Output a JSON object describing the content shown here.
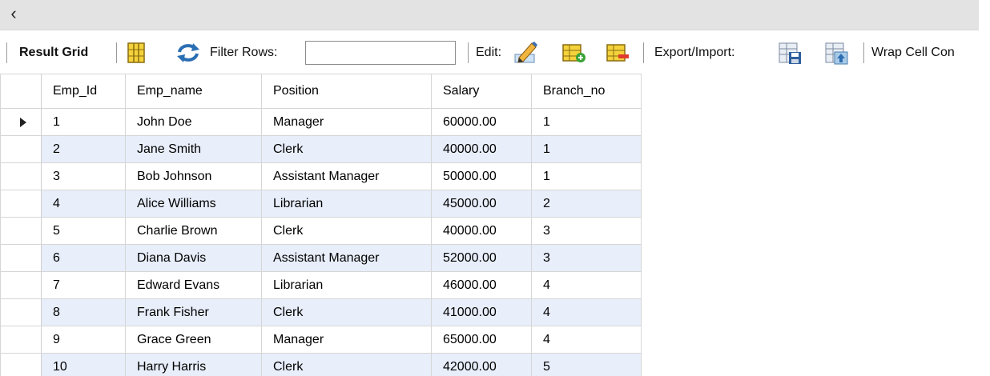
{
  "nav": {
    "back_icon": "chevron-left-icon",
    "back_glyph": "‹"
  },
  "toolbar": {
    "result_grid_label": "Result Grid",
    "filter_rows_label": "Filter Rows:",
    "filter_value": "",
    "edit_label": "Edit:",
    "export_import_label": "Export/Import:",
    "wrap_cell_label": "Wrap Cell Con"
  },
  "grid": {
    "columns": [
      "Emp_Id",
      "Emp_name",
      "Position",
      "Salary",
      "Branch_no"
    ],
    "rows": [
      [
        "1",
        "John Doe",
        "Manager",
        "60000.00",
        "1"
      ],
      [
        "2",
        "Jane Smith",
        "Clerk",
        "40000.00",
        "1"
      ],
      [
        "3",
        "Bob Johnson",
        "Assistant Manager",
        "50000.00",
        "1"
      ],
      [
        "4",
        "Alice Williams",
        "Librarian",
        "45000.00",
        "2"
      ],
      [
        "5",
        "Charlie Brown",
        "Clerk",
        "40000.00",
        "3"
      ],
      [
        "6",
        "Diana Davis",
        "Assistant Manager",
        "52000.00",
        "3"
      ],
      [
        "7",
        "Edward Evans",
        "Librarian",
        "46000.00",
        "4"
      ],
      [
        "8",
        "Frank Fisher",
        "Clerk",
        "41000.00",
        "4"
      ],
      [
        "9",
        "Grace Green",
        "Manager",
        "65000.00",
        "4"
      ],
      [
        "10",
        "Harry Harris",
        "Clerk",
        "42000.00",
        "5"
      ]
    ],
    "selected_row": 0
  },
  "colors": {
    "stripe": "#e8eefa",
    "topbar": "#e3e3e3",
    "border": "#d6d6d6"
  }
}
